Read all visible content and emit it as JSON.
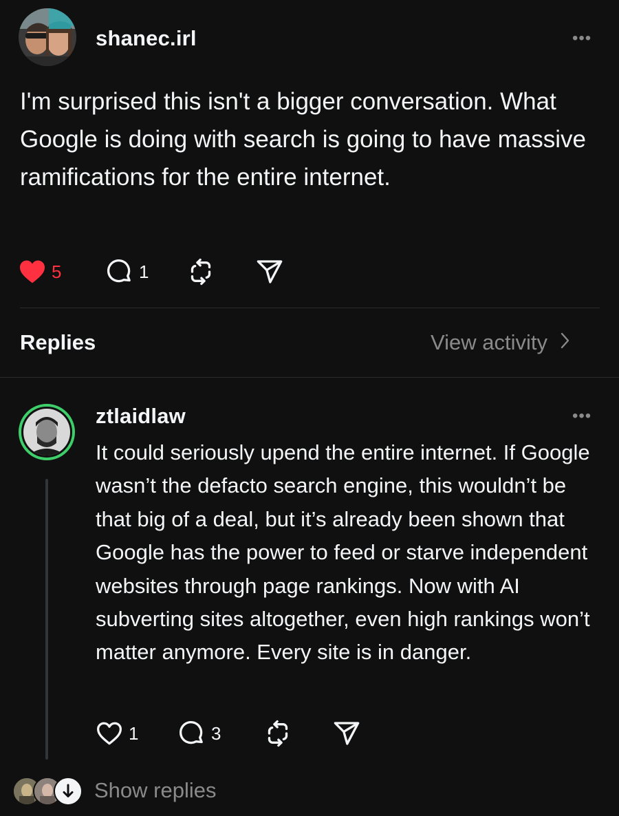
{
  "post": {
    "username": "shanec.irl",
    "more_label": "•••",
    "body": "I'm surprised this isn't a bigger conversation. What Google is doing with search is going to have massive ramifications for the entire internet.",
    "likes": "5",
    "liked": true,
    "comments": "1"
  },
  "replies_section": {
    "title": "Replies",
    "view_activity": "View activity"
  },
  "reply": {
    "username": "ztlaidlaw",
    "more_label": "•••",
    "body": "It could seriously upend the entire internet. If Google wasn’t the defacto search engine, this wouldn’t be that big of a deal, but it’s already been shown that Google has the power to feed or starve independent websites through page rankings. Now with AI subverting sites altogether, even high rankings won’t matter anymore. Every site is in danger.",
    "likes": "1",
    "comments": "3",
    "avatar_ring_color": "#3ecf6b"
  },
  "show_replies": {
    "label": "Show replies"
  },
  "colors": {
    "background": "#101010",
    "text": "#f3f5f7",
    "secondary": "#8a8a8a",
    "like_red": "#ff3040"
  },
  "icons": [
    "more-icon",
    "heart-icon",
    "comment-icon",
    "repost-icon",
    "share-icon",
    "chevron-right-icon",
    "arrow-down-icon"
  ]
}
